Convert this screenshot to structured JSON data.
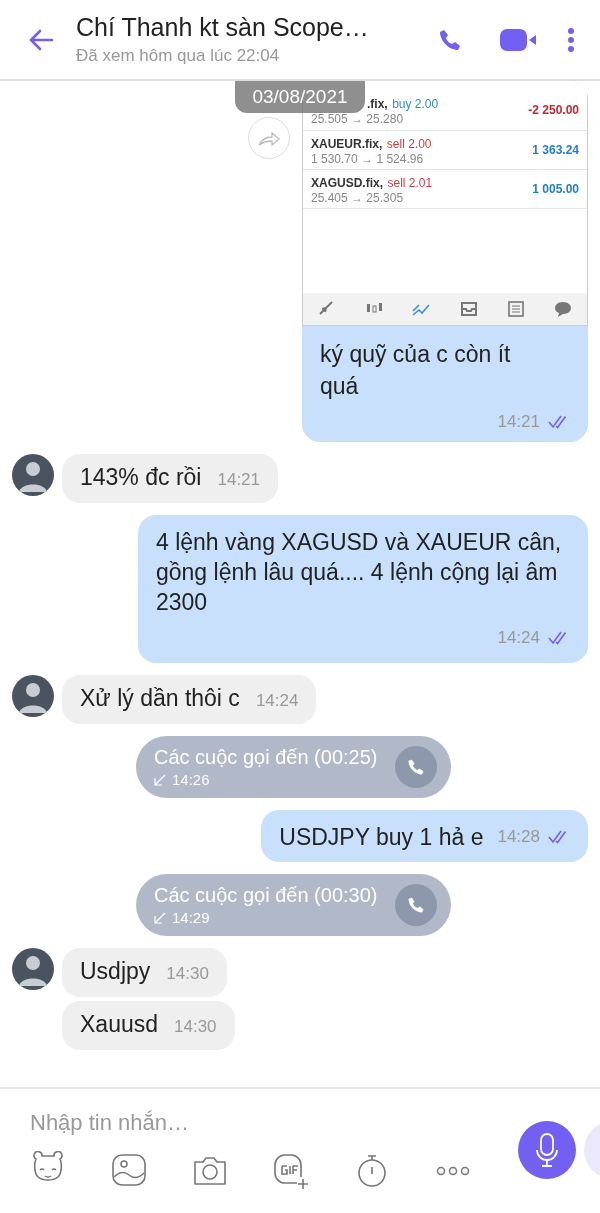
{
  "header": {
    "title": "Chí Thanh kt sàn Scope…",
    "status": "Đã xem hôm qua lúc 22:04"
  },
  "date_badge": "03/08/2021",
  "messages": [
    {
      "kind": "screenshot",
      "trades": [
        {
          "symbol": ".fix,",
          "side": {
            "text": "buy 2.00",
            "color": "#2e8bd8"
          },
          "prices": "25.505 → 25.280",
          "profit": {
            "text": "-2 250.00",
            "color": "#c8262b"
          }
        },
        {
          "symbol": "XAUEUR.fix,",
          "side": {
            "text": "sell 2.00",
            "color": "#d23c3c"
          },
          "prices": "1 530.70 → 1 524.96",
          "profit": {
            "text": "1 363.24",
            "color": "#1f7fcf"
          }
        },
        {
          "symbol": "XAGUSD.fix,",
          "side": {
            "text": "sell 2.01",
            "color": "#d23c3c"
          },
          "prices": "25.405 → 25.305",
          "profit": {
            "text": "1 005.00",
            "color": "#1f7fcf"
          }
        }
      ],
      "text": "ký quỹ của c còn ít quá",
      "time": "14:21",
      "read": true
    },
    {
      "kind": "incoming",
      "avatar": true,
      "text": "143% đc rồi",
      "time": "14:21"
    },
    {
      "kind": "outgoing",
      "text": "4 lệnh vàng XAGUSD và XAUEUR cân, gồng lệnh lâu quá.... 4 lệnh cộng lại âm 2300",
      "time": "14:24",
      "read": true
    },
    {
      "kind": "incoming",
      "avatar": true,
      "text": "Xử lý dần thôi c",
      "time": "14:24"
    },
    {
      "kind": "call",
      "label": "Các cuộc gọi đến (00:25)",
      "time": "14:26"
    },
    {
      "kind": "outgoing",
      "text": "USDJPY buy 1 hả e",
      "time": "14:28",
      "read": true
    },
    {
      "kind": "call",
      "label": "Các cuộc gọi đến (00:30)",
      "time": "14:29"
    },
    {
      "kind": "incoming",
      "avatar": true,
      "text": "Usdjpy",
      "time": "14:30"
    },
    {
      "kind": "incoming",
      "avatar": false,
      "text": "Xauusd",
      "time": "14:30"
    }
  ],
  "composer": {
    "placeholder": "Nhập tin nhắn…"
  }
}
